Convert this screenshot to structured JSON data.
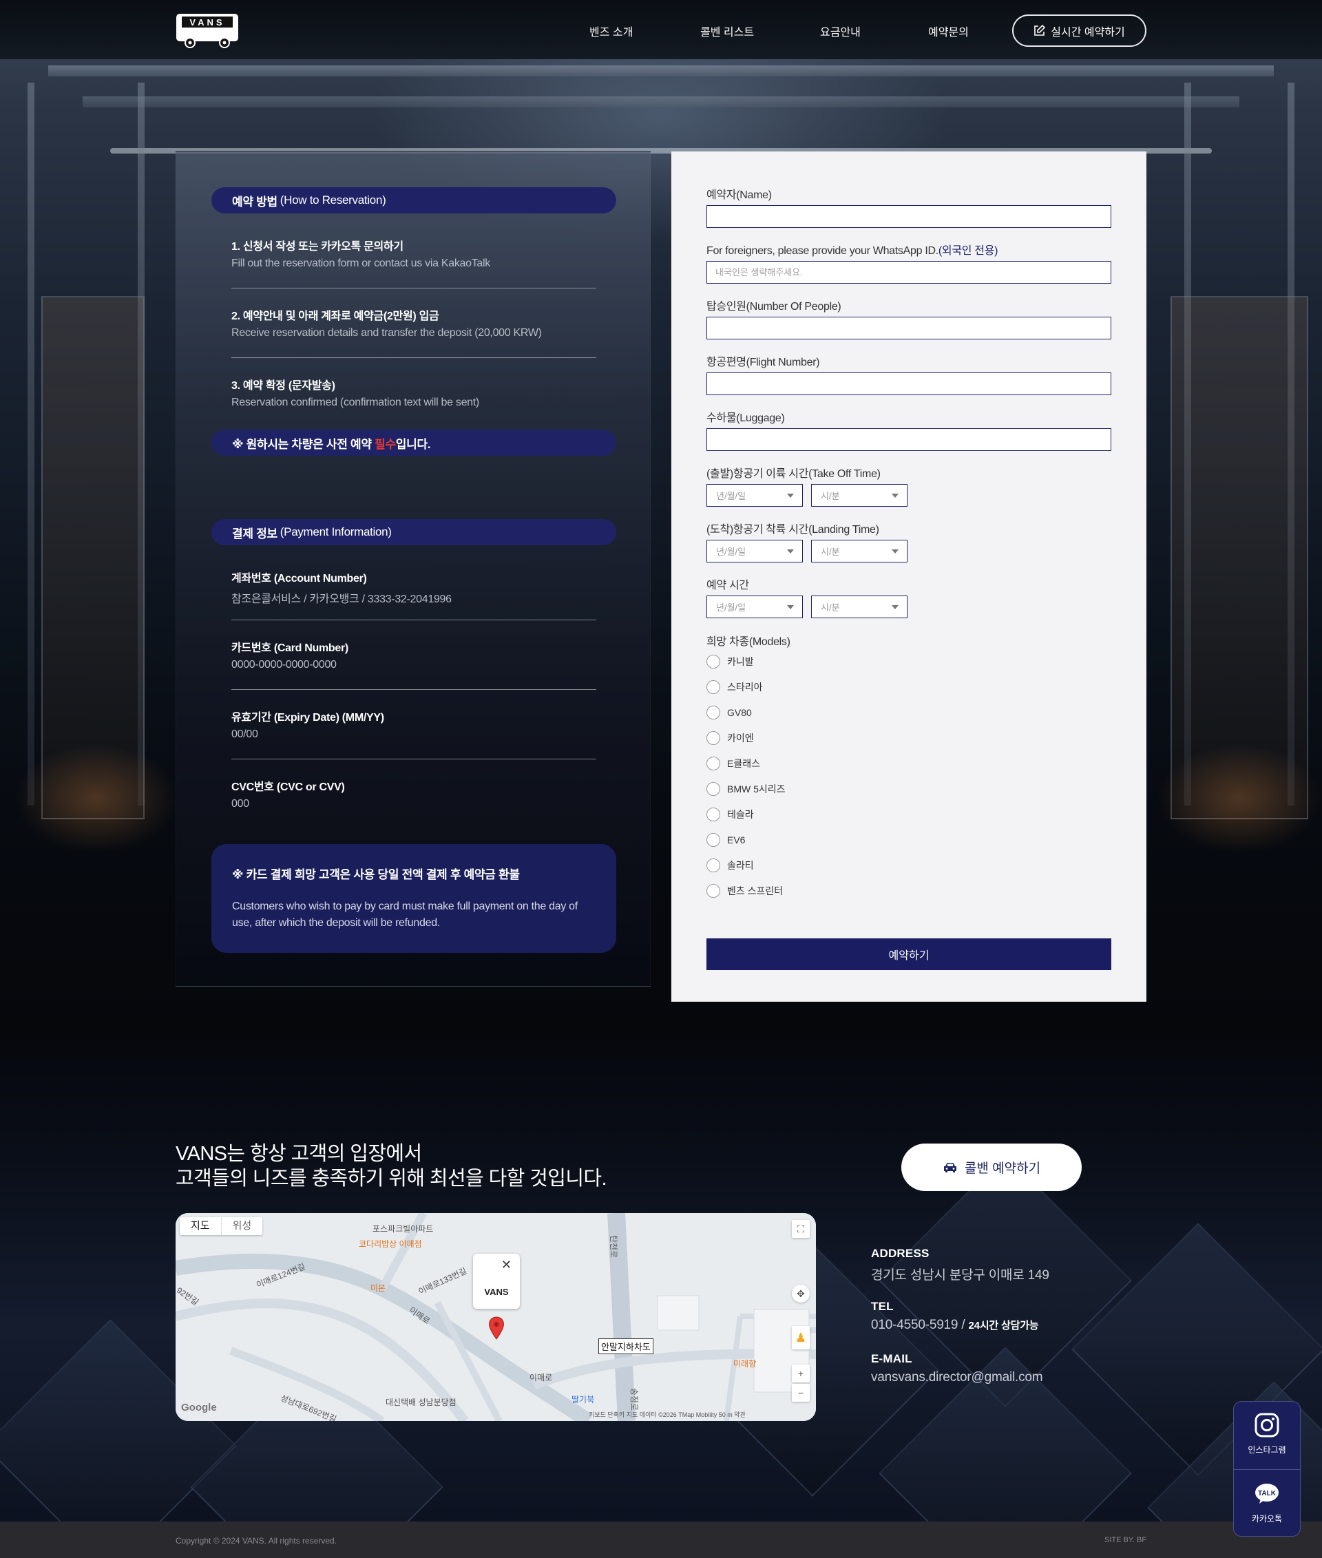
{
  "header": {
    "logo_text": "VANS",
    "nav": [
      "벤즈 소개",
      "콜벤 리스트",
      "요금안내",
      "예약문의"
    ],
    "cta_label": "실시간 예약하기"
  },
  "how_to": {
    "title_ko": "예약 방법",
    "title_en": "(How to Reservation)",
    "steps": [
      {
        "title": "1. 신청서 작성 또는 카카오톡 문의하기",
        "desc": "Fill out the reservation form or contact us via KakaoTalk"
      },
      {
        "title": "2. 예약안내 및 아래 계좌로 예약금(2만원) 입금",
        "desc": "Receive reservation details and transfer the deposit (20,000 KRW)"
      },
      {
        "title": "3. 예약 확정 (문자발송)",
        "desc": "Reservation confirmed (confirmation text will be sent)"
      }
    ],
    "notice_prefix": "※ 원하시는 차량은 사전 예약 ",
    "notice_red": "필수",
    "notice_suffix": "입니다."
  },
  "payment": {
    "title_ko": "결제 정보",
    "title_en": "(Payment Information)",
    "items": [
      {
        "title": "계좌번호 (Account Number)",
        "value": "참조은콜서비스 / 카카오뱅크 / 3333-32-2041996"
      },
      {
        "title": "카드번호 (Card Number)",
        "value": "0000-0000-0000-0000"
      },
      {
        "title": "유효기간 (Expiry Date) (MM/YY)",
        "value": "00/00"
      },
      {
        "title": "CVC번호 (CVC or CVV)",
        "value": "000"
      }
    ],
    "card_notice_title": "※ 카드 결제 희망 고객은 사용 당일 전액 결제 후 예약금 환불",
    "card_notice_desc": "Customers who wish to pay by card must make full payment on the day of use, after which the deposit will be refunded."
  },
  "form": {
    "name_label": "예약자(Name)",
    "whatsapp_label": "For foreigners, please provide your WhatsApp ID.",
    "whatsapp_label_note": "(외국인 전용)",
    "whatsapp_placeholder": "내국인은 생략해주세요.",
    "people_label": "탑승인원(Number Of People)",
    "flight_label": "항공편명(Flight Number)",
    "luggage_label": "수하물(Luggage)",
    "takeoff_label": "(출발)항공기 이륙 시간(Take Off Time)",
    "landing_label": "(도착)항공기 착륙 시간(Landing Time)",
    "reserve_time_label": "예약 시간",
    "date_placeholder": "년/월/일",
    "time_placeholder": "시/분",
    "models_label": "희망 차종(Models)",
    "models": [
      "카니발",
      "스타리아",
      "GV80",
      "카이엔",
      "E클래스",
      "BMW 5시리즈",
      "테슬라",
      "EV6",
      "솔라티",
      "벤츠 스프린터"
    ],
    "submit_label": "예약하기"
  },
  "lower": {
    "slogan_line1": "VANS는 항상 고객의 입장에서",
    "slogan_line2": "고객들의 니즈를 충족하기 위해 최선을 다할 것입니다.",
    "book_button": "콜밴 예약하기"
  },
  "map": {
    "tab_map": "지도",
    "tab_satellite": "위성",
    "marker_name": "VANS",
    "station_label": "안말지하차도",
    "labels": [
      "포스파크빌아파트",
      "코다리밥상 이매점",
      "미본",
      "이매로124번길",
      "이매로133번길",
      "이매로",
      "이매로",
      "미래향",
      "딸기북",
      "대신택배 성남분당점",
      "성남대로692번길",
      "92번길",
      "탄천로",
      "송정로"
    ],
    "google": "Google",
    "attribution": "키보드 단축키  지도 데이터 ©2026 TMap Mobility   50 m        약관"
  },
  "contact": {
    "address_label": "ADDRESS",
    "address": "경기도 성남시 분당구 이매로 149",
    "tel_label": "TEL",
    "tel": "010-4550-5919",
    "tel_sep": " / ",
    "tel_note": "24시간 상담가능",
    "email_label": "E-MAIL",
    "email": "vansvans.director@gmail.com"
  },
  "footer": {
    "copyright": "Copyright © 2024 VANS. All rights reserved.",
    "site_by": "SITE BY. BF"
  },
  "floating": {
    "instagram": "인스타그램",
    "kakao": "카카오톡",
    "kakao_badge": "TALK"
  },
  "colors": {
    "navy": "#1f2366",
    "required_red": "#e53935",
    "form_bg": "#f3f3f5"
  }
}
